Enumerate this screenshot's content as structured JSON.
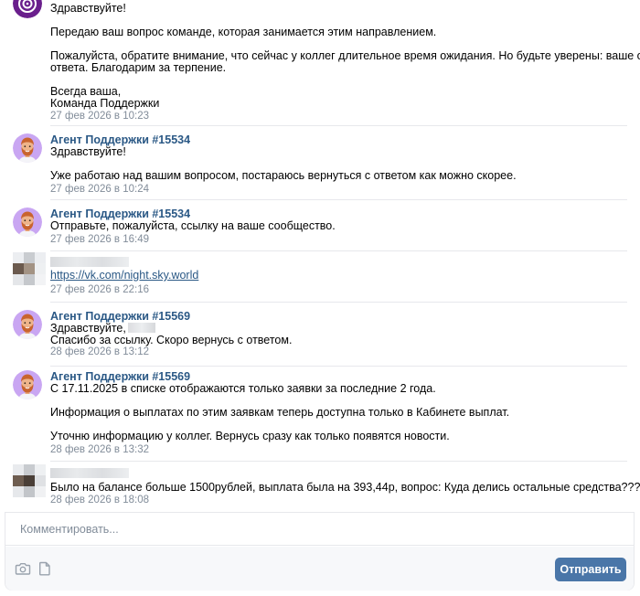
{
  "messages": [
    {
      "id": "m1",
      "author": "",
      "avatar": "support-logo",
      "lines": [
        "Здравствуйте!",
        "Передаю ваш вопрос команде, которая занимается этим направлением.",
        "Пожалуйста, обратите внимание, что сейчас у коллег длительное время ожидания. Но будьте уверены: ваше обращение не останется без",
        "ответа. Благодарим за терпение.",
        "Всегда ваша,",
        "Команда Поддержки"
      ],
      "time": "27 фев 2026 в 10:23"
    },
    {
      "id": "m2",
      "author": "Агент Поддержки #15534",
      "lines": [
        "Здравствуйте!",
        "Уже работаю над вашим вопросом, постараюсь вернуться с ответом как можно скорее."
      ],
      "time": "27 фев 2026 в 10:24"
    },
    {
      "id": "m3",
      "author": "Агент Поддержки #15534",
      "lines": [
        "Отправьте, пожалуйста, ссылку на ваше сообщество."
      ],
      "time": "27 фев 2026 в 16:49"
    },
    {
      "id": "m4",
      "author": "",
      "link": "https://vk.com/night.sky.world",
      "time": "27 фев 2026 в 22:16"
    },
    {
      "id": "m5",
      "author": "Агент Поддержки #15569",
      "lines": [
        "Здравствуйте,",
        "Спасибо за ссылку. Скоро вернусь с ответом."
      ],
      "time": "28 фев 2026 в 13:12"
    },
    {
      "id": "m6",
      "author": "Агент Поддержки #15569",
      "lines": [
        "С 17.11.2025 в списке отображаются только заявки за последние 2 года.",
        "Информация о выплатах по этим заявкам теперь доступна только в Кабинете выплат.",
        "Уточню информацию у коллег. Вернусь сразу как только появятся новости."
      ],
      "time": "28 фев 2026 в 13:32"
    },
    {
      "id": "m7",
      "author": "",
      "lines": [
        "Было на балансе больше 1500рублей, выплата была на 393,44р, вопрос: Куда делись остальные средства???"
      ],
      "time": "28 фев 2026 в 18:08"
    }
  ],
  "composer": {
    "placeholder": "Комментировать...",
    "send_label": "Отправить",
    "icons": [
      "camera-icon",
      "document-icon"
    ]
  },
  "colors": {
    "author": "#2a5885",
    "time": "#818c99",
    "send_button": "#4a76a8",
    "avatar_bg": "#c9a6f2",
    "logo": "#6a1f8c"
  }
}
